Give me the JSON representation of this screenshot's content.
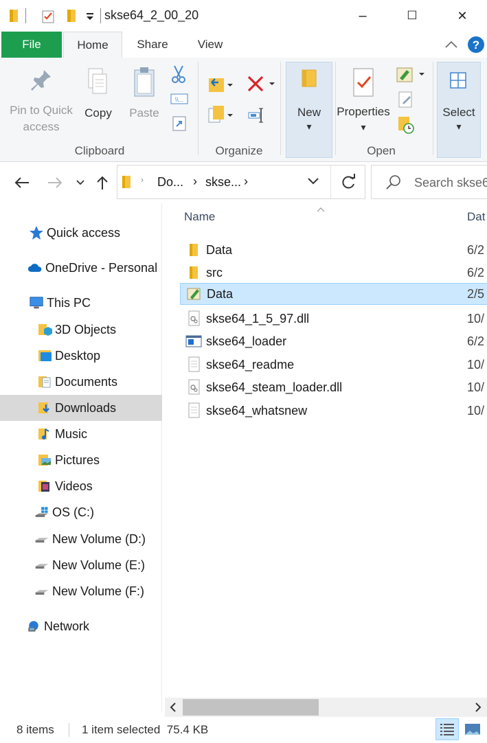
{
  "window": {
    "title": "skse64_2_00_20",
    "minimize": "–",
    "maximize": "☐",
    "close": "✕"
  },
  "ribbon_tabs": [
    "File",
    "Home",
    "Share",
    "View"
  ],
  "ribbon": {
    "clipboard": {
      "group_label": "Clipboard",
      "pin_line1": "Pin to Quick",
      "pin_line2": "access",
      "copy": "Copy",
      "paste": "Paste"
    },
    "organize": {
      "group_label": "Organize"
    },
    "new": {
      "label": "New",
      "arrow": "▾"
    },
    "open": {
      "group_label": "Open",
      "properties": "Properties",
      "arrow": "▾"
    },
    "select": {
      "label": "Select",
      "arrow": "▾"
    }
  },
  "address": {
    "crumb1": "Do...",
    "crumb2": "skse...",
    "sep": "›",
    "search_placeholder": "Search skse6"
  },
  "columns": {
    "name": "Name",
    "date": "Dat"
  },
  "nav_pane": [
    {
      "label": "Quick access",
      "icon": "star-icon"
    },
    {
      "label": "OneDrive - Personal",
      "icon": "cloud-icon"
    },
    {
      "label": "This PC",
      "icon": "computer-icon"
    },
    {
      "label": "3D Objects",
      "icon": "cube-folder-icon"
    },
    {
      "label": "Desktop",
      "icon": "desktop-folder-icon"
    },
    {
      "label": "Documents",
      "icon": "documents-folder-icon"
    },
    {
      "label": "Downloads",
      "icon": "downloads-folder-icon"
    },
    {
      "label": "Music",
      "icon": "music-folder-icon"
    },
    {
      "label": "Pictures",
      "icon": "pictures-folder-icon"
    },
    {
      "label": "Videos",
      "icon": "videos-folder-icon"
    },
    {
      "label": "OS (C:)",
      "icon": "windows-drive-icon"
    },
    {
      "label": "New Volume (D:)",
      "icon": "drive-icon"
    },
    {
      "label": "New Volume (E:)",
      "icon": "drive-icon"
    },
    {
      "label": "New Volume (F:)",
      "icon": "drive-icon"
    },
    {
      "label": "Network",
      "icon": "network-icon"
    }
  ],
  "files": [
    {
      "name": "Data",
      "date": "6/2",
      "icon": "folder-icon"
    },
    {
      "name": "src",
      "date": "6/2",
      "icon": "folder-icon"
    },
    {
      "name": "Data",
      "date": "2/5",
      "icon": "registry-file-icon"
    },
    {
      "name": "skse64_1_5_97.dll",
      "date": "10/",
      "icon": "dll-file-icon"
    },
    {
      "name": "skse64_loader",
      "date": "6/2",
      "icon": "application-icon"
    },
    {
      "name": "skse64_readme",
      "date": "10/",
      "icon": "text-file-icon"
    },
    {
      "name": "skse64_steam_loader.dll",
      "date": "10/",
      "icon": "dll-file-icon"
    },
    {
      "name": "skse64_whatsnew",
      "date": "10/",
      "icon": "text-file-icon"
    }
  ],
  "status": {
    "items": "8 items",
    "selected": "1 item selected  75.4 KB"
  },
  "colors": {
    "file_tab": "#1d9e4f",
    "selection": "#cce8ff",
    "nav_selection": "#d9d9d9",
    "folder": "#f5c342"
  }
}
